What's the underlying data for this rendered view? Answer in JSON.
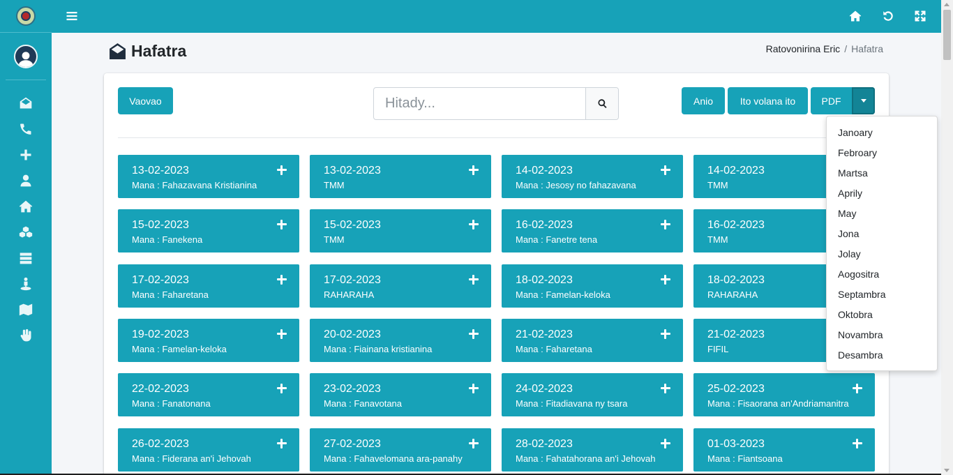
{
  "colors": {
    "accent": "#17a2b8",
    "background": "#f4f6f9",
    "text": "#212529"
  },
  "sidebar": {
    "logo_icon": "church-logo-icon",
    "avatar_icon": "user-avatar-icon",
    "items": [
      {
        "icon": "envelope-open-icon"
      },
      {
        "icon": "phone-icon"
      },
      {
        "icon": "plus-icon"
      },
      {
        "icon": "user-icon"
      },
      {
        "icon": "home-icon"
      },
      {
        "icon": "cubes-icon"
      },
      {
        "icon": "server-icon"
      },
      {
        "icon": "person-standing-icon"
      },
      {
        "icon": "map-icon"
      },
      {
        "icon": "hand-icon"
      }
    ]
  },
  "topbar": {
    "menu_icon": "bars-icon",
    "icons": [
      "home-icon",
      "undo-icon",
      "expand-icon"
    ]
  },
  "header": {
    "title": "Hafatra",
    "title_icon": "envelope-open-icon"
  },
  "breadcrumb": {
    "parent": "Ratovonirina Eric",
    "separator": "/",
    "current": "Hafatra"
  },
  "toolbar": {
    "new_label": "Vaovao",
    "search_placeholder": "Hitady...",
    "search_icon": "search-icon",
    "today_label": "Anio",
    "this_month_label": "Ito volana ito",
    "pdf_label": "PDF",
    "pdf_toggle_icon": "caret-down-icon"
  },
  "months_dropdown": [
    "Janoary",
    "Febroary",
    "Martsa",
    "Aprily",
    "May",
    "Jona",
    "Jolay",
    "Aogositra",
    "Septambra",
    "Oktobra",
    "Novambra",
    "Desambra"
  ],
  "messages": [
    {
      "date": "13-02-2023",
      "desc": "Mana : Fahazavana Kristianina"
    },
    {
      "date": "13-02-2023",
      "desc": "TMM"
    },
    {
      "date": "14-02-2023",
      "desc": "Mana : Jesosy no fahazavana"
    },
    {
      "date": "14-02-2023",
      "desc": "TMM"
    },
    {
      "date": "15-02-2023",
      "desc": "Mana : Fanekena"
    },
    {
      "date": "15-02-2023",
      "desc": "TMM"
    },
    {
      "date": "16-02-2023",
      "desc": "Mana : Fanetre tena"
    },
    {
      "date": "16-02-2023",
      "desc": "TMM"
    },
    {
      "date": "17-02-2023",
      "desc": "Mana : Faharetana"
    },
    {
      "date": "17-02-2023",
      "desc": "RAHARAHA"
    },
    {
      "date": "18-02-2023",
      "desc": "Mana : Famelan-keloka"
    },
    {
      "date": "18-02-2023",
      "desc": "RAHARAHA"
    },
    {
      "date": "19-02-2023",
      "desc": "Mana : Famelan-keloka"
    },
    {
      "date": "20-02-2023",
      "desc": "Mana : Fiainana kristianina"
    },
    {
      "date": "21-02-2023",
      "desc": "Mana : Faharetana"
    },
    {
      "date": "21-02-2023",
      "desc": "FIFIL"
    },
    {
      "date": "22-02-2023",
      "desc": "Mana : Fanatonana"
    },
    {
      "date": "23-02-2023",
      "desc": "Mana : Fanavotana"
    },
    {
      "date": "24-02-2023",
      "desc": "Mana : Fitadiavana ny tsara"
    },
    {
      "date": "25-02-2023",
      "desc": "Mana : Fisaorana an'Andriamanitra"
    },
    {
      "date": "26-02-2023",
      "desc": "Mana : Fiderana an'i Jehovah"
    },
    {
      "date": "27-02-2023",
      "desc": "Mana : Fahavelomana ara-panahy"
    },
    {
      "date": "28-02-2023",
      "desc": "Mana : Fahatahorana an'i Jehovah"
    },
    {
      "date": "01-03-2023",
      "desc": "Mana : Fiantsoana"
    }
  ]
}
